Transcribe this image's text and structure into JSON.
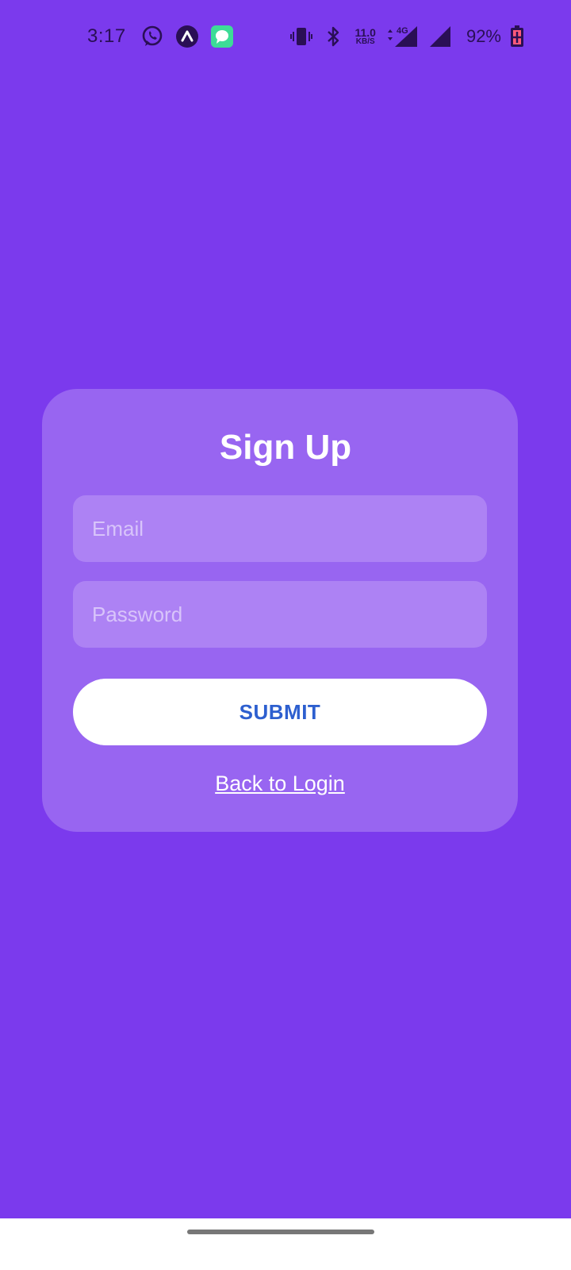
{
  "status_bar": {
    "time": "3:17",
    "net_speed_value": "11.0",
    "net_speed_unit": "KB/S",
    "network_type": "4G",
    "battery": "92%",
    "icons": [
      "whatsapp-icon",
      "app-a-icon",
      "messages-icon",
      "vibrate-icon",
      "bluetooth-icon",
      "data-arrows-icon",
      "signal-icon",
      "signal-icon",
      "battery-charging-icon"
    ]
  },
  "form": {
    "title": "Sign Up",
    "email_placeholder": "Email",
    "email_value": "",
    "password_placeholder": "Password",
    "password_value": "",
    "submit_label": "SUBMIT",
    "back_link_label": "Back to Login"
  },
  "colors": {
    "background": "#7b3aed",
    "card": "#9865f1",
    "input": "#ad82f4",
    "button_text": "#2d5fcf"
  }
}
